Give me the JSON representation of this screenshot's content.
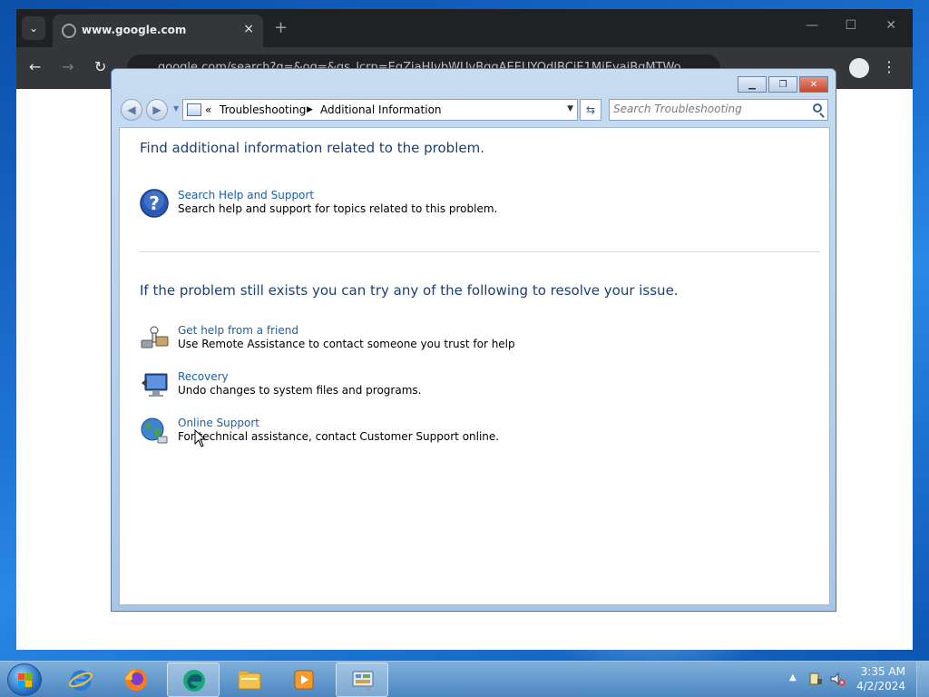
{
  "browser": {
    "tab_title": "www.google.com",
    "omnibox_text": "google.com/search?q=&oq=&gs_lcrp=EgZjaHJvbWUyBggAEEUYOdIBCjE1MjEyajBqMTWo",
    "new_tab": "+",
    "close": "×",
    "menu_glyph": "⋮"
  },
  "window": {
    "breadcrumb_prefix": "«",
    "breadcrumb": [
      "Troubleshooting",
      "Additional Information"
    ],
    "search_placeholder": "Search Troubleshooting"
  },
  "content": {
    "heading1": "Find additional information related to the problem.",
    "heading2": "If the problem still exists you can try any of the following to resolve your issue.",
    "tasks": [
      {
        "link": "Search Help and Support",
        "desc": "Search help and support for topics related to this problem.",
        "icon": "help-icon"
      },
      {
        "link": "Get help from a friend",
        "desc": "Use Remote Assistance to contact someone you trust for help",
        "icon": "remote-assistance-icon"
      },
      {
        "link": "Recovery",
        "desc": "Undo changes to system files and programs.",
        "icon": "recovery-icon"
      },
      {
        "link": "Online Support",
        "desc": "For technical assistance, contact Customer Support online.",
        "icon": "globe-icon"
      }
    ]
  },
  "taskbar": {
    "time": "3:35 AM",
    "date": "4/2/2024",
    "apps": [
      "internet-explorer-icon",
      "firefox-icon",
      "edge-beta-icon",
      "file-explorer-icon",
      "media-player-icon",
      "control-panel-icon"
    ]
  },
  "colors": {
    "link": "#1a5fa8",
    "heading": "#1b3f77",
    "chrome_dark": "#202124"
  }
}
